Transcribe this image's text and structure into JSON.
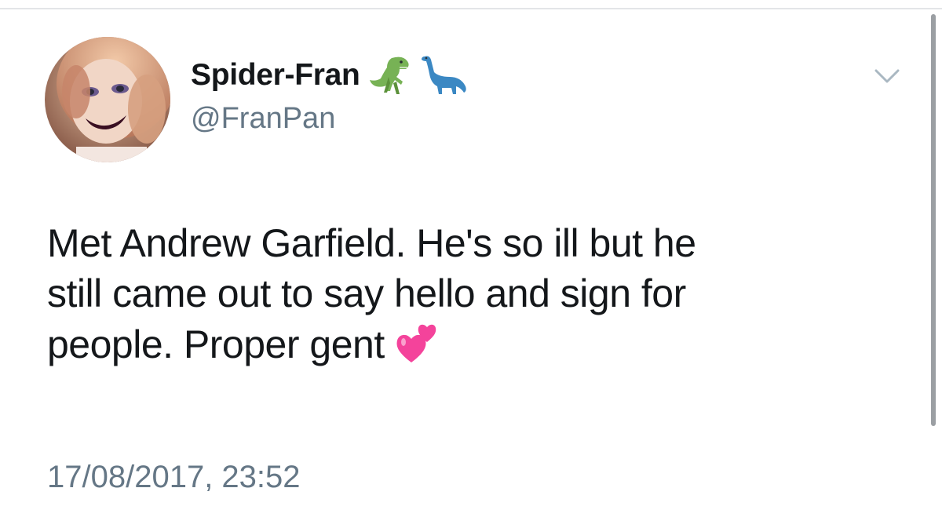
{
  "tweet": {
    "display_name": "Spider-Fran",
    "name_emoji": [
      "t-rex-icon",
      "sauropod-icon"
    ],
    "handle": "@FranPan",
    "text_lines": [
      "Met Andrew Garfield. He's so ill but he",
      "still came out to say hello and sign for",
      "people. Proper gent"
    ],
    "text_emoji": "two-hearts-icon",
    "timestamp": "17/08/2017, 23:52"
  },
  "colors": {
    "primary_text": "#14171a",
    "secondary_text": "#657786",
    "divider": "#e3e5e8",
    "caret": "#aab8c2",
    "scrollbar": "#9b9fa3"
  }
}
